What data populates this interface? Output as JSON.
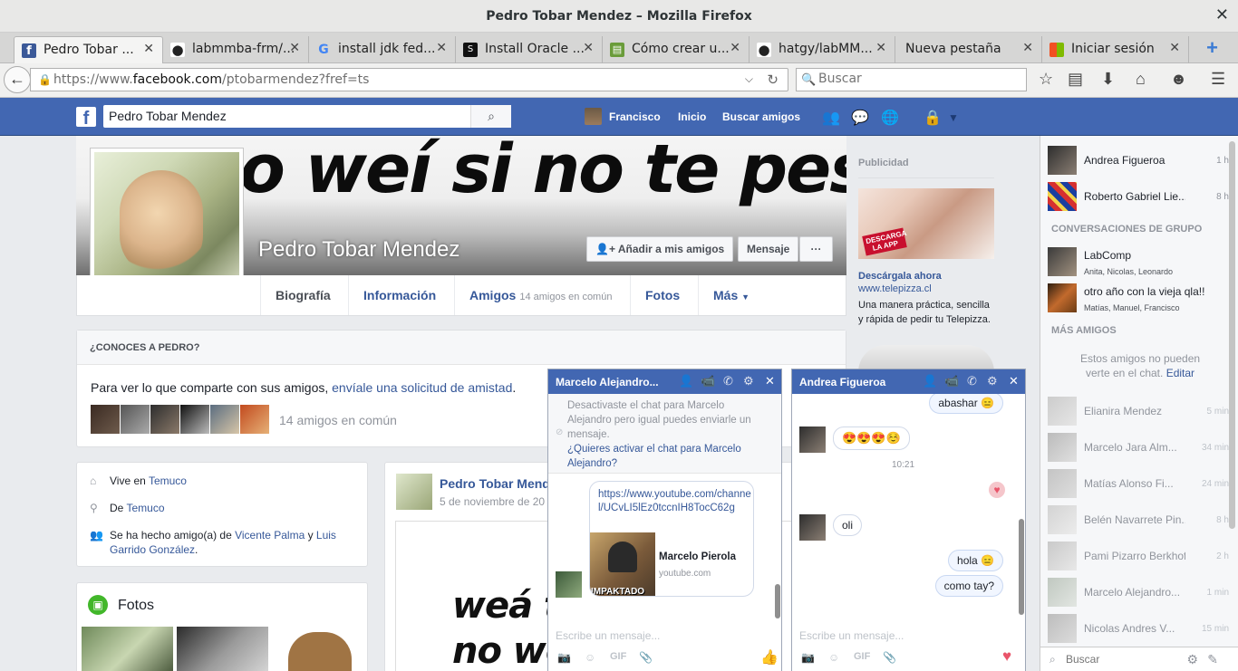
{
  "window": {
    "title": "Pedro Tobar Mendez – Mozilla Firefox"
  },
  "tabs": [
    {
      "label": "Pedro Tobar ...",
      "favicon_color": "#3b5998",
      "favicon_glyph": "f",
      "active": true
    },
    {
      "label": "labmmba-frm/...",
      "favicon_color": "#222222",
      "favicon_glyph": "●"
    },
    {
      "label": "install jdk fed...",
      "favicon_color": "#ffffff",
      "favicon_glyph": "G"
    },
    {
      "label": "Install Oracle ...",
      "favicon_color": "#111111",
      "favicon_glyph": "S"
    },
    {
      "label": "Cómo crear u...",
      "favicon_color": "#6a9c3a",
      "favicon_glyph": "▤"
    },
    {
      "label": "hatgy/labMM...",
      "favicon_color": "#222222",
      "favicon_glyph": "●"
    },
    {
      "label": "Nueva pestaña",
      "favicon_color": "",
      "favicon_glyph": ""
    },
    {
      "label": "Iniciar sesión",
      "favicon_color": "#f25022",
      "favicon_glyph": "■"
    }
  ],
  "navbar": {
    "url_prefix": "https://www.",
    "url_domain": "facebook.com",
    "url_path": "/ptobarmendez?fref=ts",
    "search_placeholder": "Buscar"
  },
  "fb": {
    "logo": "f",
    "search_value": "Pedro Tobar Mendez",
    "user_name": "Francisco",
    "nav_home": "Inicio",
    "nav_find_friends": "Buscar amigos"
  },
  "profile": {
    "cover_text": "o weí si no te pesco.",
    "name": "Pedro Tobar Mendez",
    "add_friend_label": "Añadir a mis amigos",
    "message_label": "Mensaje",
    "more_label": "···",
    "tabs": [
      {
        "label": "Biografía",
        "sub": ""
      },
      {
        "label": "Información",
        "sub": ""
      },
      {
        "label": "Amigos",
        "sub": "14 amigos en común"
      },
      {
        "label": "Fotos",
        "sub": ""
      },
      {
        "label": "Más",
        "sub": ""
      }
    ]
  },
  "know": {
    "header": "¿CONOCES A PEDRO?",
    "text": "Para ver lo que comparte con sus amigos, ",
    "link": "envíale una solicitud de amistad",
    "text_end": ".",
    "common": "14 amigos en común"
  },
  "intro": {
    "lives_prefix": "Vive en ",
    "lives_city": "Temuco",
    "from_prefix": "De ",
    "from_city": "Temuco",
    "friends_prefix": "Se ha hecho amigo(a) de ",
    "friend1": "Vicente Palma",
    "and": " y ",
    "friend2": "Luis Garrido González",
    "end": "."
  },
  "photos": {
    "title": "Fotos"
  },
  "post": {
    "author": "Pedro Tobar Mende",
    "date": "5 de noviembre de 20",
    "image_line1": "weá tu",
    "image_line2": "no we"
  },
  "ads": {
    "header": "Publicidad",
    "badge": "DESCARGA LA APP",
    "title": "Descárgala ahora",
    "url": "www.telepizza.cl",
    "text": "Una manera práctica, sencilla y rápida de pedir tu Telepizza."
  },
  "chat_sidebar": {
    "recent": [
      {
        "name": "Andrea Figueroa",
        "time": "1 h"
      },
      {
        "name": "Roberto Gabriel Lie...",
        "time": "8 h"
      }
    ],
    "group_header": "CONVERSACIONES DE GRUPO",
    "groups": [
      {
        "name": "LabComp",
        "members": "Anita, Nicolas, Leonardo"
      },
      {
        "name": "otro año con la vieja qla!!",
        "members": "Matías, Manuel, Francisco"
      }
    ],
    "more_header": "MÁS AMIGOS",
    "note": "Estos amigos no pueden verte en el chat.",
    "note_link": "Editar",
    "offline": [
      {
        "name": "Elianira Mendez",
        "time": "5 min"
      },
      {
        "name": "Marcelo Jara Alm...",
        "time": "34 min"
      },
      {
        "name": "Matías Alonso Fi...",
        "time": "24 min"
      },
      {
        "name": "Belén Navarrete Pin...",
        "time": "8 h"
      },
      {
        "name": "Pami Pizarro Berkhoff",
        "time": "2 h"
      },
      {
        "name": "Marcelo Alejandro...",
        "time": "1 min"
      },
      {
        "name": "Nicolas Andres V...",
        "time": "15 min"
      }
    ],
    "search_placeholder": "Buscar"
  },
  "chat1": {
    "title": "Marcelo Alejandro...",
    "notice": "Desactivaste el chat para Marcelo Alejandro pero igual puedes enviarle un mensaje.",
    "notice_link": "¿Quieres activar el chat para Marcelo Alejandro?",
    "link_url": "https://www.youtube.com/channel/UCvLI5lEz0tccnIH8TocC62g",
    "link_title": "Marcelo Pierola",
    "link_domain": "youtube.com",
    "thumb_text": "IMPAKTADO",
    "input_placeholder": "Escribe un mensaje...",
    "gif": "GIF"
  },
  "chat2": {
    "title": "Andrea Figueroa",
    "messages": [
      {
        "text": "abashar 😑"
      },
      {
        "text": "😍😍😍☺️"
      },
      {
        "text": "10:21"
      },
      {
        "text": "oli"
      },
      {
        "text": "hola 😑"
      },
      {
        "text": "como tay?"
      }
    ],
    "input_placeholder": "Escribe un mensaje...",
    "gif": "GIF"
  }
}
